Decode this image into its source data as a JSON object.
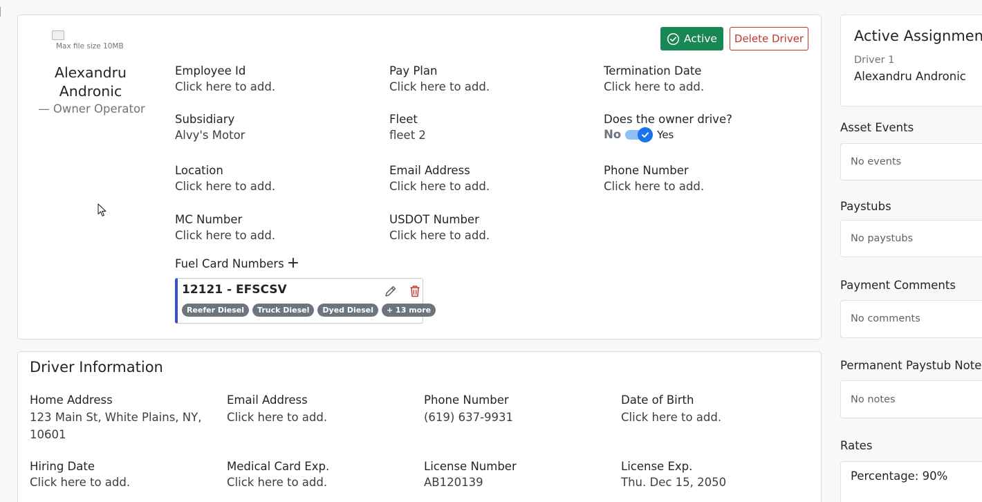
{
  "profile": {
    "avatar_alt": "Max file size 10MB",
    "name_line1": "Alexandru",
    "name_line2": "Andronic",
    "type": "— Owner Operator"
  },
  "header": {
    "status_label": "Active",
    "delete_label": "Delete Driver"
  },
  "fields": {
    "employee_id": {
      "label": "Employee Id",
      "value": "Click here to add."
    },
    "pay_plan": {
      "label": "Pay Plan",
      "value": "Click here to add."
    },
    "termination_date": {
      "label": "Termination Date",
      "value": "Click here to add."
    },
    "subsidiary": {
      "label": "Subsidiary",
      "value": "Alvy's Motor"
    },
    "fleet": {
      "label": "Fleet",
      "value": "fleet 2"
    },
    "owner_drive": {
      "label": "Does the owner drive?",
      "off_label": "No",
      "on_label": "Yes",
      "checked": true
    },
    "location": {
      "label": "Location",
      "value": "Click here to add."
    },
    "email": {
      "label": "Email Address",
      "value": "Click here to add."
    },
    "phone": {
      "label": "Phone Number",
      "value": "Click here to add."
    },
    "mc_number": {
      "label": "MC Number",
      "value": "Click here to add."
    },
    "usdot_number": {
      "label": "USDOT Number",
      "value": "Click here to add."
    }
  },
  "fuel_cards": {
    "title": "Fuel Card Numbers",
    "items": [
      {
        "name": "12121 - EFSCSV",
        "chips": [
          "Reefer Diesel",
          "Truck Diesel",
          "Dyed Diesel",
          "+ 13 more"
        ]
      }
    ]
  },
  "driver_info": {
    "title": "Driver Information",
    "home_address": {
      "label": "Home Address",
      "value_line1": "123 Main St, White Plains, NY,",
      "value_line2": "10601"
    },
    "email": {
      "label": "Email Address",
      "value": "Click here to add."
    },
    "phone": {
      "label": "Phone Number",
      "value": "(619) 637-9931"
    },
    "dob": {
      "label": "Date of Birth",
      "value": "Click here to add."
    },
    "hiring_date": {
      "label": "Hiring Date",
      "value": "Click here to add."
    },
    "medical_card": {
      "label": "Medical Card Exp.",
      "value": "Click here to add."
    },
    "license_number": {
      "label": "License Number",
      "value": "AB120139"
    },
    "license_exp": {
      "label": "License Exp.",
      "value": "Thu. Dec 15, 2050"
    }
  },
  "sidebar": {
    "assignments": {
      "title": "Active Assignments",
      "driver_label": "Driver 1",
      "driver_name": "Alexandru Andronic"
    },
    "asset_events": {
      "title": "Asset Events",
      "empty": "No events"
    },
    "paystubs": {
      "title": "Paystubs",
      "empty": "No paystubs"
    },
    "payment_comments": {
      "title": "Payment Comments",
      "empty": "No comments"
    },
    "paystub_notes": {
      "title": "Permanent Paystub Notes",
      "empty": "No notes"
    },
    "rates": {
      "title": "Rates",
      "percentage_label": "Percentage:",
      "percentage_value": "90%"
    }
  },
  "colors": {
    "active_green": "#198754",
    "delete_red": "#c0392b",
    "fuel_card_accent": "#3451d1",
    "toggle_blue": "#1a73e8",
    "chip_gray": "#6c757d"
  }
}
